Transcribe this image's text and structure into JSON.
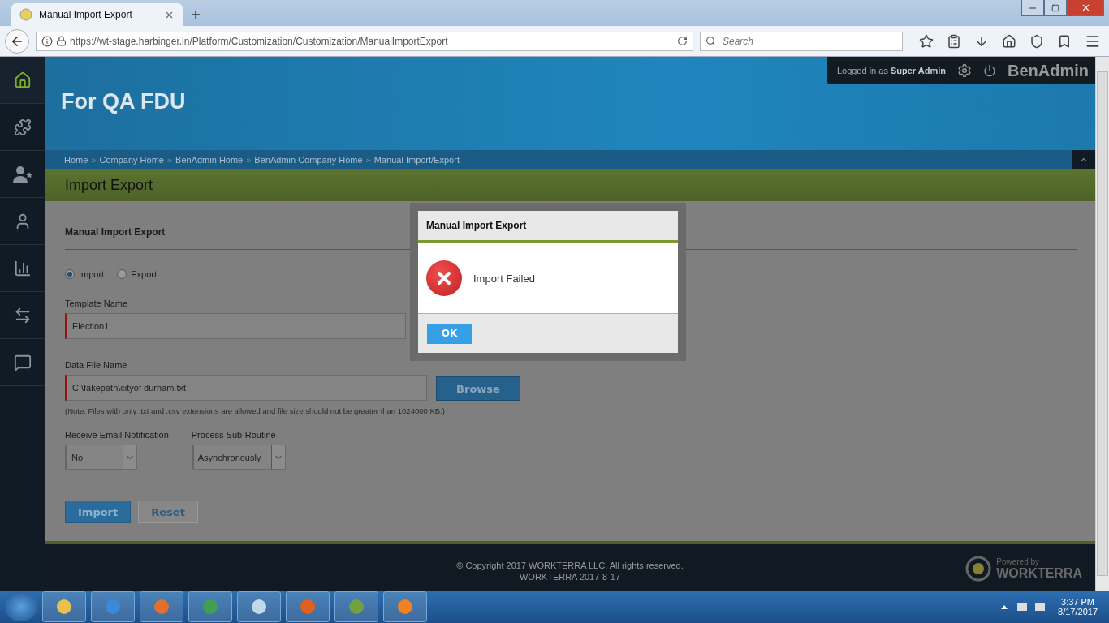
{
  "browser": {
    "tab_title": "Manual Import Export",
    "url": "https://wt-stage.harbinger.in/Platform/Customization/Customization/ManualImportExport",
    "search_placeholder": "Search"
  },
  "sidebar": {
    "items": [
      {
        "kind": "home",
        "selected": true
      },
      {
        "kind": "puzzle",
        "selected": false
      },
      {
        "kind": "user-star",
        "selected": false
      },
      {
        "kind": "user",
        "selected": false
      },
      {
        "kind": "chart",
        "selected": false
      },
      {
        "kind": "arrows",
        "selected": false
      },
      {
        "kind": "chat",
        "selected": false
      }
    ]
  },
  "header": {
    "company": "For QA FDU",
    "user_label": "Logged in as",
    "user_name": "Super Admin",
    "app_name": "BenAdmin"
  },
  "breadcrumbs": [
    {
      "label": "Home",
      "separator": "»"
    },
    {
      "label": "Company Home",
      "separator": "»"
    },
    {
      "label": "BenAdmin Home",
      "separator": "»"
    },
    {
      "label": "BenAdmin Company Home",
      "separator": "»"
    },
    {
      "label": "Manual Import/Export"
    }
  ],
  "page_title": "Import Export",
  "form": {
    "section_title": "Manual Import Export",
    "modes": [
      {
        "label": "Import",
        "selected": true
      },
      {
        "label": "Export",
        "selected": false
      }
    ],
    "template": {
      "label": "Template Name",
      "value": "Election1"
    },
    "data_file": {
      "label": "Data File Name",
      "value": "C:\\fakepath\\cityof durham.txt",
      "browse": "Browse"
    },
    "note": "(Note: Files with only .txt and .csv extensions are allowed and file size should not be greater than 1024000 KB.)",
    "email": {
      "label": "Receive Email Notification",
      "value": "No"
    },
    "subroutine": {
      "label": "Process Sub-Routine",
      "value": "Asynchronously"
    },
    "buttons": [
      {
        "label": "Import",
        "kind": "primary"
      },
      {
        "label": "Reset",
        "kind": "secondary"
      }
    ]
  },
  "dialog": {
    "title": "Manual Import Export",
    "message": "Import Failed",
    "ok": "OK"
  },
  "footer": {
    "copyright": "© Copyright 2017 WORKTERRA LLC. All rights reserved.",
    "version": "WORKTERRA 2017-8-17",
    "powered_by": "Powered by",
    "brand": "WORKTERRA"
  },
  "taskbar": {
    "time": "3:37 PM",
    "date": "8/17/2017"
  }
}
